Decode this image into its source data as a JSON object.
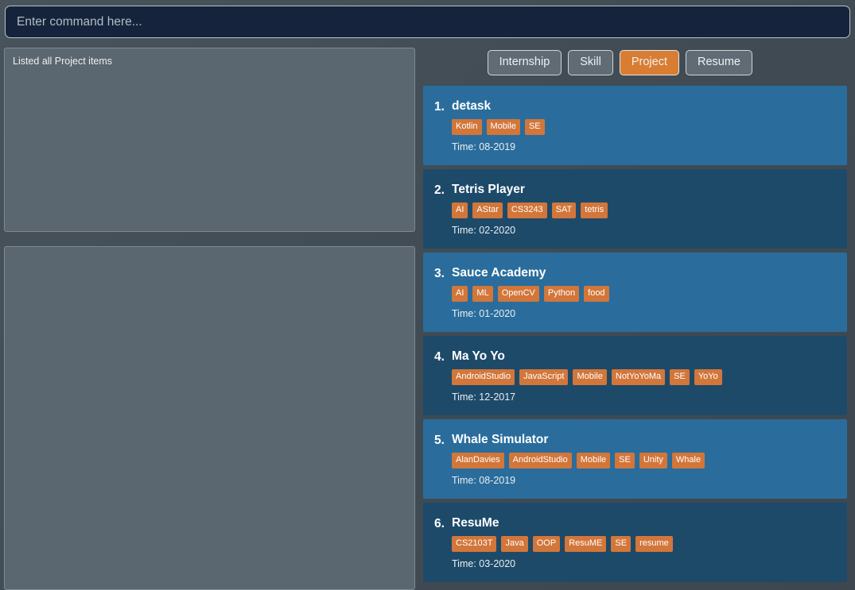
{
  "command": {
    "placeholder": "Enter command here...",
    "value": ""
  },
  "result_panel": {
    "text": "Listed all Project items"
  },
  "detail_panel": {
    "text": ""
  },
  "tabs": [
    {
      "label": "Internship",
      "active": false
    },
    {
      "label": "Skill",
      "active": false
    },
    {
      "label": "Project",
      "active": true
    },
    {
      "label": "Resume",
      "active": false
    }
  ],
  "colors": {
    "accent": "#d97d33",
    "tag": "#d2763a",
    "card_odd": "#2a6d9c",
    "card_even": "#1e4a6a",
    "panel": "#5a6670",
    "background": "#434e56",
    "input_background": "#15243c"
  },
  "time_label_prefix": "Time: ",
  "cards": [
    {
      "index": "1.",
      "title": "detask",
      "tags": [
        "Kotlin",
        "Mobile",
        "SE"
      ],
      "time": "Time: 08-2019"
    },
    {
      "index": "2.",
      "title": "Tetris Player",
      "tags": [
        "AI",
        "AStar",
        "CS3243",
        "SAT",
        "tetris"
      ],
      "time": "Time: 02-2020"
    },
    {
      "index": "3.",
      "title": "Sauce Academy",
      "tags": [
        "AI",
        "ML",
        "OpenCV",
        "Python",
        "food"
      ],
      "time": "Time: 01-2020"
    },
    {
      "index": "4.",
      "title": "Ma Yo Yo",
      "tags": [
        "AndroidStudio",
        "JavaScript",
        "Mobile",
        "NotYoYoMa",
        "SE",
        "YoYo"
      ],
      "time": "Time: 12-2017"
    },
    {
      "index": "5.",
      "title": "Whale Simulator",
      "tags": [
        "AlanDavies",
        "AndroidStudio",
        "Mobile",
        "SE",
        "Unity",
        "Whale"
      ],
      "time": "Time: 08-2019"
    },
    {
      "index": "6.",
      "title": "ResuMe",
      "tags": [
        "CS2103T",
        "Java",
        "OOP",
        "ResuME",
        "SE",
        "resume"
      ],
      "time": "Time: 03-2020"
    }
  ]
}
